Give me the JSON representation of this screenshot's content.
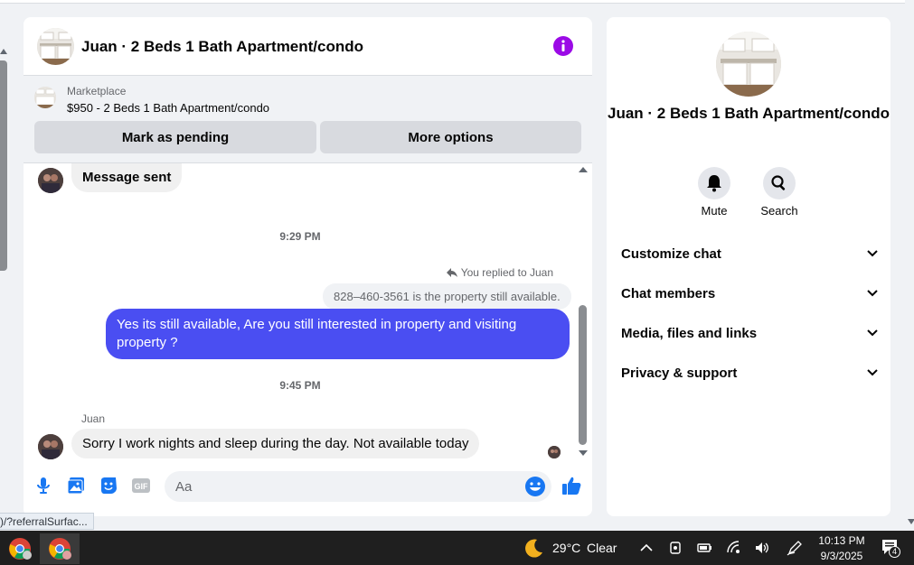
{
  "chat": {
    "title": "Juan · 2 Beds 1 Bath Apartment/condo",
    "icons": {
      "info": "info-icon"
    },
    "accent": "#9b0ae6"
  },
  "marketplace": {
    "label": "Marketplace",
    "listing": "$950 - 2 Beds 1 Bath Apartment/condo",
    "mark_pending": "Mark as pending",
    "more_options": "More options"
  },
  "messages": {
    "sent_text": "Message sent",
    "time1": "9:29 PM",
    "replied_label": "You replied to Juan",
    "quoted_text": "828–460-3561 is the property still available.",
    "outgoing_text": "Yes its still available, Are you still interested in property and visiting property ?",
    "time2": "9:45 PM",
    "sender": "Juan",
    "incoming_text": "Sorry I work nights and sleep during the day. Not available today",
    "outgoing_color": "#4a4ef2"
  },
  "composer": {
    "placeholder": "Aa",
    "icons": [
      "microphone-icon",
      "photo-icon",
      "sticker-icon",
      "gif-icon",
      "emoji-icon",
      "thumbs-up-icon"
    ],
    "gif_label": "GIF"
  },
  "side": {
    "title": "Juan · 2 Beds 1 Bath Apartment/condo",
    "mute": "Mute",
    "search": "Search",
    "sections": [
      "Customize chat",
      "Chat members",
      "Media, files and links",
      "Privacy & support"
    ]
  },
  "status_url": ")/?referralSurfac...",
  "taskbar": {
    "temperature": "29°C",
    "weather": "Clear",
    "time": "10:13 PM",
    "date": "9/3/2025",
    "notifications": "4"
  }
}
